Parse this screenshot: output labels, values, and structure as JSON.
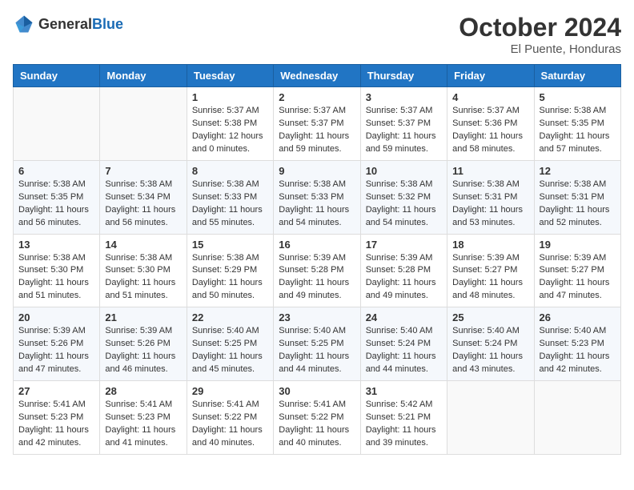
{
  "logo": {
    "text_general": "General",
    "text_blue": "Blue"
  },
  "title": {
    "month_year": "October 2024",
    "location": "El Puente, Honduras"
  },
  "headers": [
    "Sunday",
    "Monday",
    "Tuesday",
    "Wednesday",
    "Thursday",
    "Friday",
    "Saturday"
  ],
  "weeks": [
    [
      {
        "day": "",
        "info": ""
      },
      {
        "day": "",
        "info": ""
      },
      {
        "day": "1",
        "info": "Sunrise: 5:37 AM\nSunset: 5:38 PM\nDaylight: 12 hours\nand 0 minutes."
      },
      {
        "day": "2",
        "info": "Sunrise: 5:37 AM\nSunset: 5:37 PM\nDaylight: 11 hours\nand 59 minutes."
      },
      {
        "day": "3",
        "info": "Sunrise: 5:37 AM\nSunset: 5:37 PM\nDaylight: 11 hours\nand 59 minutes."
      },
      {
        "day": "4",
        "info": "Sunrise: 5:37 AM\nSunset: 5:36 PM\nDaylight: 11 hours\nand 58 minutes."
      },
      {
        "day": "5",
        "info": "Sunrise: 5:38 AM\nSunset: 5:35 PM\nDaylight: 11 hours\nand 57 minutes."
      }
    ],
    [
      {
        "day": "6",
        "info": "Sunrise: 5:38 AM\nSunset: 5:35 PM\nDaylight: 11 hours\nand 56 minutes."
      },
      {
        "day": "7",
        "info": "Sunrise: 5:38 AM\nSunset: 5:34 PM\nDaylight: 11 hours\nand 56 minutes."
      },
      {
        "day": "8",
        "info": "Sunrise: 5:38 AM\nSunset: 5:33 PM\nDaylight: 11 hours\nand 55 minutes."
      },
      {
        "day": "9",
        "info": "Sunrise: 5:38 AM\nSunset: 5:33 PM\nDaylight: 11 hours\nand 54 minutes."
      },
      {
        "day": "10",
        "info": "Sunrise: 5:38 AM\nSunset: 5:32 PM\nDaylight: 11 hours\nand 54 minutes."
      },
      {
        "day": "11",
        "info": "Sunrise: 5:38 AM\nSunset: 5:31 PM\nDaylight: 11 hours\nand 53 minutes."
      },
      {
        "day": "12",
        "info": "Sunrise: 5:38 AM\nSunset: 5:31 PM\nDaylight: 11 hours\nand 52 minutes."
      }
    ],
    [
      {
        "day": "13",
        "info": "Sunrise: 5:38 AM\nSunset: 5:30 PM\nDaylight: 11 hours\nand 51 minutes."
      },
      {
        "day": "14",
        "info": "Sunrise: 5:38 AM\nSunset: 5:30 PM\nDaylight: 11 hours\nand 51 minutes."
      },
      {
        "day": "15",
        "info": "Sunrise: 5:38 AM\nSunset: 5:29 PM\nDaylight: 11 hours\nand 50 minutes."
      },
      {
        "day": "16",
        "info": "Sunrise: 5:39 AM\nSunset: 5:28 PM\nDaylight: 11 hours\nand 49 minutes."
      },
      {
        "day": "17",
        "info": "Sunrise: 5:39 AM\nSunset: 5:28 PM\nDaylight: 11 hours\nand 49 minutes."
      },
      {
        "day": "18",
        "info": "Sunrise: 5:39 AM\nSunset: 5:27 PM\nDaylight: 11 hours\nand 48 minutes."
      },
      {
        "day": "19",
        "info": "Sunrise: 5:39 AM\nSunset: 5:27 PM\nDaylight: 11 hours\nand 47 minutes."
      }
    ],
    [
      {
        "day": "20",
        "info": "Sunrise: 5:39 AM\nSunset: 5:26 PM\nDaylight: 11 hours\nand 47 minutes."
      },
      {
        "day": "21",
        "info": "Sunrise: 5:39 AM\nSunset: 5:26 PM\nDaylight: 11 hours\nand 46 minutes."
      },
      {
        "day": "22",
        "info": "Sunrise: 5:40 AM\nSunset: 5:25 PM\nDaylight: 11 hours\nand 45 minutes."
      },
      {
        "day": "23",
        "info": "Sunrise: 5:40 AM\nSunset: 5:25 PM\nDaylight: 11 hours\nand 44 minutes."
      },
      {
        "day": "24",
        "info": "Sunrise: 5:40 AM\nSunset: 5:24 PM\nDaylight: 11 hours\nand 44 minutes."
      },
      {
        "day": "25",
        "info": "Sunrise: 5:40 AM\nSunset: 5:24 PM\nDaylight: 11 hours\nand 43 minutes."
      },
      {
        "day": "26",
        "info": "Sunrise: 5:40 AM\nSunset: 5:23 PM\nDaylight: 11 hours\nand 42 minutes."
      }
    ],
    [
      {
        "day": "27",
        "info": "Sunrise: 5:41 AM\nSunset: 5:23 PM\nDaylight: 11 hours\nand 42 minutes."
      },
      {
        "day": "28",
        "info": "Sunrise: 5:41 AM\nSunset: 5:23 PM\nDaylight: 11 hours\nand 41 minutes."
      },
      {
        "day": "29",
        "info": "Sunrise: 5:41 AM\nSunset: 5:22 PM\nDaylight: 11 hours\nand 40 minutes."
      },
      {
        "day": "30",
        "info": "Sunrise: 5:41 AM\nSunset: 5:22 PM\nDaylight: 11 hours\nand 40 minutes."
      },
      {
        "day": "31",
        "info": "Sunrise: 5:42 AM\nSunset: 5:21 PM\nDaylight: 11 hours\nand 39 minutes."
      },
      {
        "day": "",
        "info": ""
      },
      {
        "day": "",
        "info": ""
      }
    ]
  ]
}
